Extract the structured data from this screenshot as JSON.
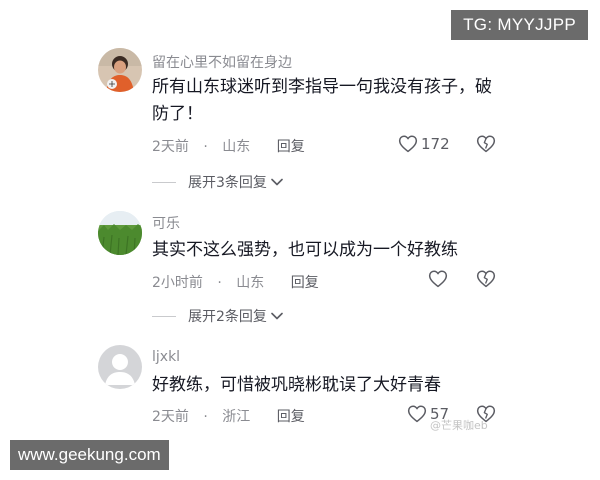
{
  "watermarks": {
    "top_right": "TG: MYYJJPP",
    "bottom_left": "www.geekung.com"
  },
  "comments": [
    {
      "username": "留在心里不如留在身边",
      "text": "所有山东球迷听到李指导一句我没有孩子，破防了！",
      "time": "2天前",
      "location": "山东",
      "reply_label": "回复",
      "likes": "172",
      "expand_label": "展开3条回复",
      "avatar": "person-photo"
    },
    {
      "username": "可乐",
      "text": "其实不这么强势，也可以成为一个好教练",
      "time": "2小时前",
      "location": "山东",
      "reply_label": "回复",
      "likes": "",
      "expand_label": "展开2条回复",
      "avatar": "grass-photo"
    },
    {
      "username": "ljxkl",
      "text": "好教练，可惜被巩晓彬耽误了大好青春",
      "time": "2天前",
      "location": "浙江",
      "reply_label": "回复",
      "likes": "57",
      "expand_label": "",
      "avatar": "default-avatar"
    }
  ],
  "faint_watermark": "@芒果咖eb",
  "icons": [
    "heart-icon",
    "broken-heart-icon",
    "chevron-down-icon"
  ],
  "colors": {
    "secondary_text": "#8a8b91",
    "primary_text": "#161823",
    "watermark_bg": "#6b6b6b"
  }
}
